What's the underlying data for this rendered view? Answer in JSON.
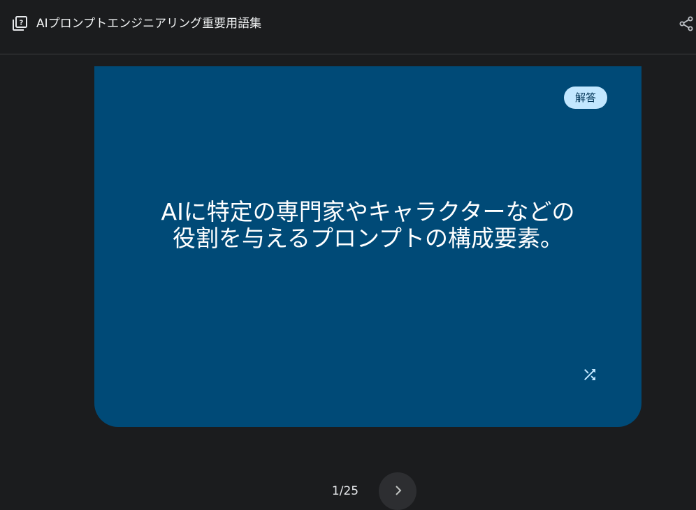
{
  "header": {
    "title": "AIプロンプトエンジニアリング重要用語集",
    "left_icon": "flashcards-icon",
    "right_icon": "share-icon"
  },
  "card": {
    "badge_label": "解答",
    "text_lines": [
      "AIに特定の専門家やキャラクターなどの",
      "役割を与えるプロンプトの構成要素。"
    ],
    "shuffle_icon": "shuffle-icon",
    "background_color": "#004a77"
  },
  "navigation": {
    "counter": "1/25",
    "next_icon": "chevron-right-icon"
  }
}
